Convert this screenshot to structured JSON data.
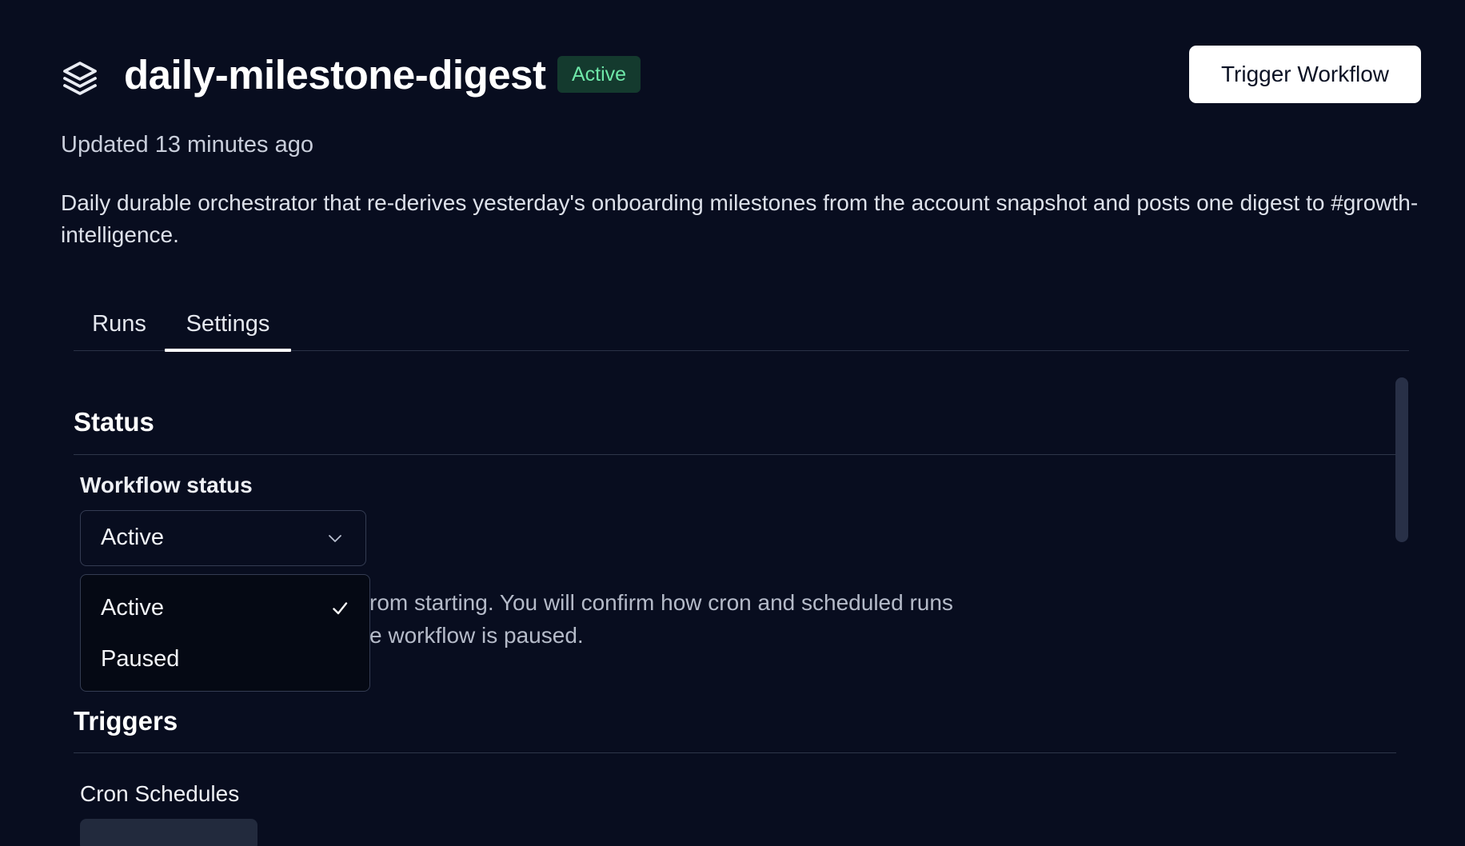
{
  "header": {
    "title": "daily-milestone-digest",
    "status_badge": "Active",
    "trigger_button": "Trigger Workflow",
    "updated": "Updated 13 minutes ago",
    "description": "Daily durable orchestrator that re-derives yesterday's onboarding milestones from the account snapshot and posts one digest to #growth-intelligence.",
    "icon": "layers-icon"
  },
  "tabs": [
    {
      "label": "Runs",
      "active": false
    },
    {
      "label": "Settings",
      "active": true
    }
  ],
  "status_section": {
    "heading": "Status",
    "field_label": "Workflow status",
    "selected_value": "Active",
    "options": [
      {
        "label": "Active",
        "selected": true
      },
      {
        "label": "Paused",
        "selected": false
      }
    ],
    "help_text_visible": "rom starting. You will confirm how cron and scheduled runs\ne workflow is paused."
  },
  "triggers_section": {
    "heading": "Triggers",
    "field_label": "Cron Schedules"
  },
  "colors": {
    "background": "#080d1f",
    "badge_bg": "#143a2e",
    "badge_text": "#6ee7a8",
    "button_bg": "#ffffff",
    "button_text": "#0b1224"
  }
}
